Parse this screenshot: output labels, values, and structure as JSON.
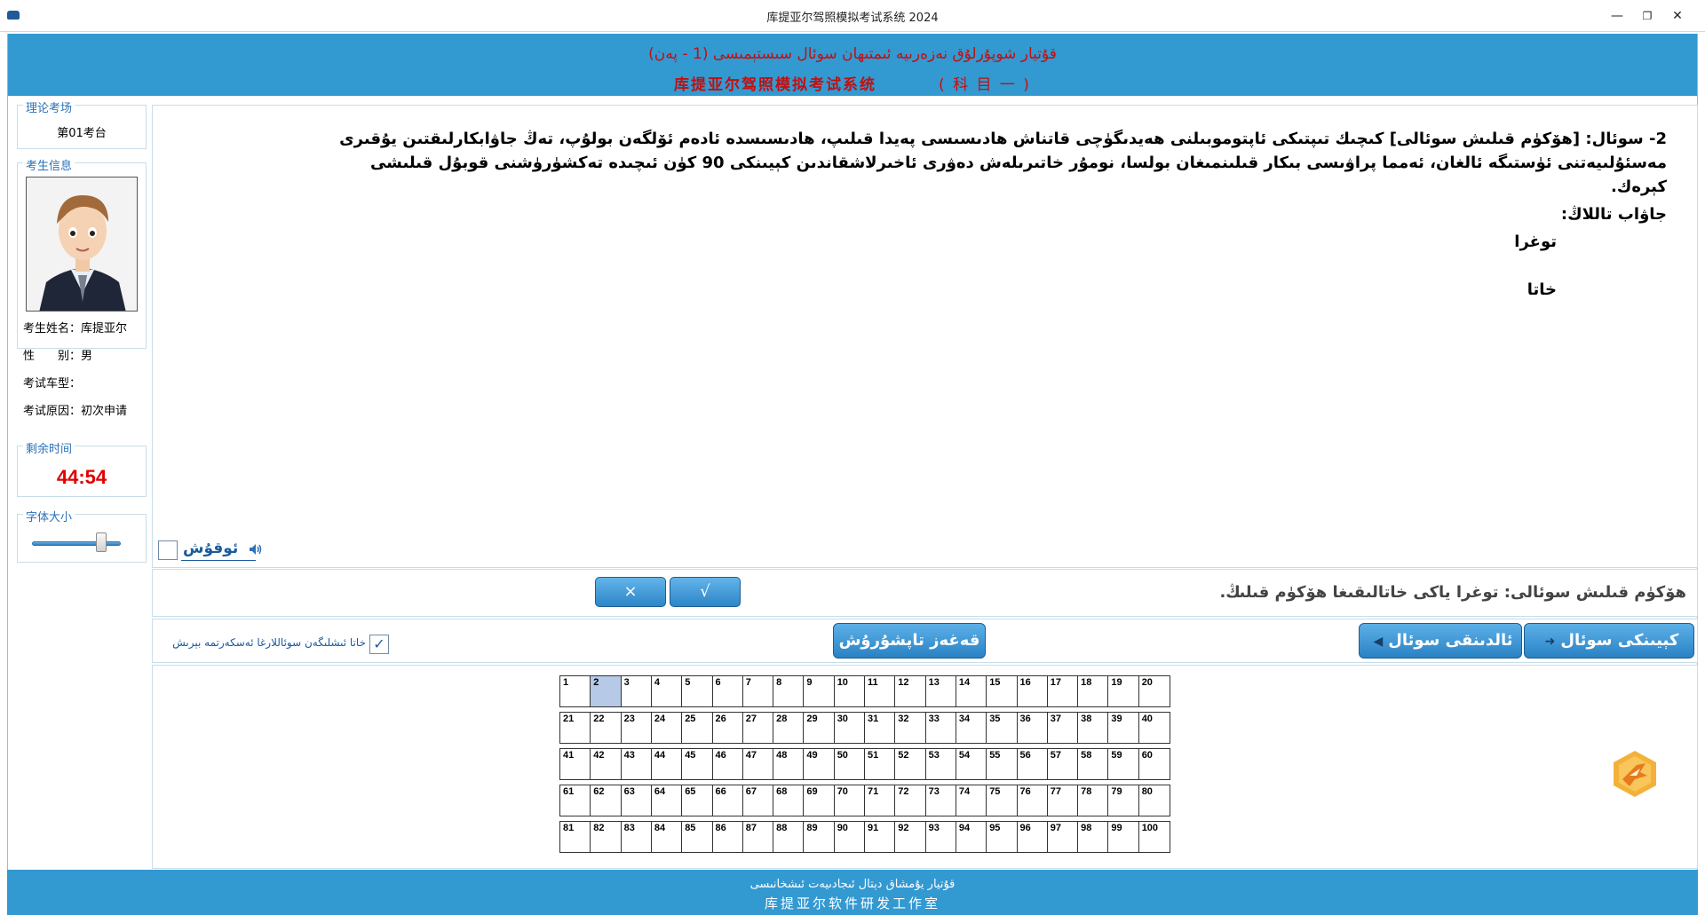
{
  "window": {
    "title": "库提亚尔驾照模拟考试系统 2024",
    "minimize": "—",
    "maximize": "❐",
    "close": "✕"
  },
  "banner": {
    "ug_title": "قۇتيار شوپۇرلۇق نەزەرىيە ئىمتىھان سوئال سىستېمىسى (1 - پەن)",
    "cn_title": "库提亚尔驾照模拟考试系统",
    "cn_subject": "( 科 目 一 )"
  },
  "sidebar": {
    "venue": {
      "legend": "理论考场",
      "value": "第01考台"
    },
    "student": {
      "legend": "考生信息",
      "name": "考生姓名：库提亚尔",
      "gender": "性　　别：男",
      "vehicle": "考试车型：",
      "reason": "考试原因：初次申请"
    },
    "time": {
      "legend": "剩余时间",
      "value": "44:54"
    },
    "font": {
      "legend": "字体大小",
      "level": 0.78
    }
  },
  "question": {
    "text": "2- سوئال:  [ھۆكۈم قىلىش سوئالى] كىچىك تىپتىكى ئاپتوموبىلنى ھەيدىگۈچى قاتناش ھادىسىسى پەيدا قىلىپ، ھادىسىسدە ئادەم ئۆلگەن بولۇپ، تەڭ جاۋابكارلىقتىن يۇقىرى مەسئۇلىيەتنى ئۈستىگە ئالغان، ئەمما پراۋىسى بىكار قىلىنمىغان بولسا، نومۇر خاتىرىلەش دەۋرى ئاخىرلاشقاندىن كېيىنكى 90 كۈن ئىچىدە تەكشۈرۈشنى قوبۇل قىلىشى كېرەك.",
    "answer_label": "جاۋاب تاللاڭ:",
    "options": [
      "توغرا",
      "خاتا"
    ],
    "read_label": "ئوقۇش"
  },
  "answer_bar": {
    "wrong_label": "×",
    "right_label": "√",
    "hint": "ھۆكۈم قىلىش سوئالى: توغرا ياكى خاتالىقىغا ھۆكۈم قىلىڭ."
  },
  "nav": {
    "confirm_label": "خاتا ئىشلىگەن سوئاللارغا ئەسكەرتمە بېرىش",
    "confirm_check": "✓",
    "submit_label": "قەغەز تاپشۇرۇش",
    "prev_label": "ئالدىنقى سوئال",
    "next_label": "كېيىنكى سوئال",
    "arrow": "➜"
  },
  "grid": {
    "count": 100,
    "per_row": 20,
    "current": 2
  },
  "footer": {
    "ug": "قۇتيار يۇمشاق دېتال ئىجادىيەت ئىشخانىسى",
    "cn": "库提亚尔软件研发工作室"
  },
  "colors": {
    "accent": "#3399d1",
    "title_red": "#c01010",
    "timer_red": "#e00000",
    "current_cell": "#b6c9e6"
  }
}
